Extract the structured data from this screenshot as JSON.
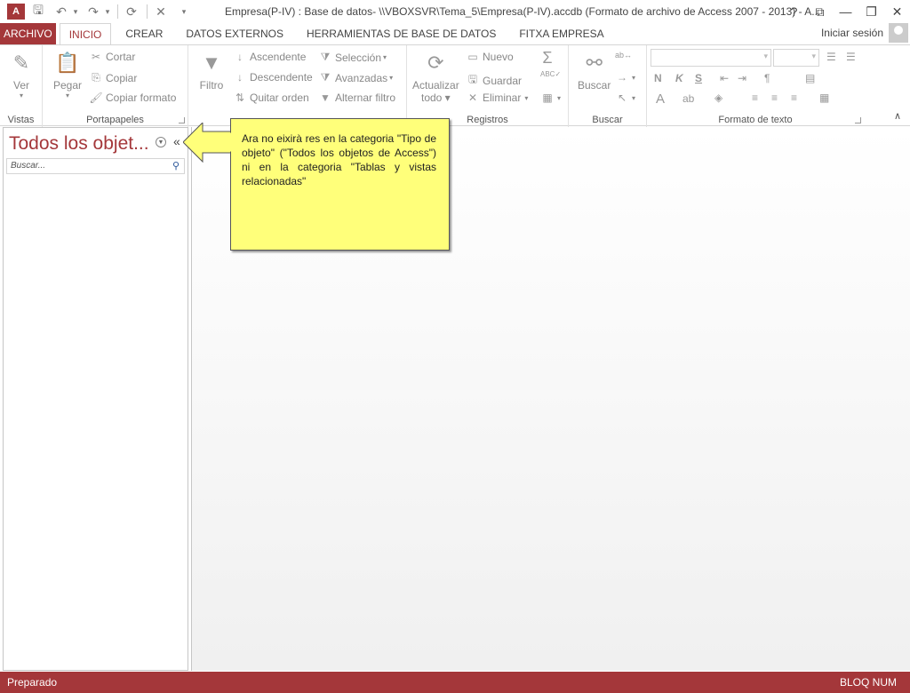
{
  "window": {
    "title": "Empresa(P-IV) : Base de datos- \\\\VBOXSVR\\Tema_5\\Empresa(P-IV).accdb (Formato de archivo de Access 2007 - 2013) - A...",
    "app_icon": "A",
    "help": "?",
    "restore_ribbon": "⧉",
    "minimize": "—",
    "maximize": "❐",
    "close": "✕"
  },
  "tabs": {
    "file": "ARCHIVO",
    "items": [
      "INICIO",
      "CREAR",
      "DATOS EXTERNOS",
      "HERRAMIENTAS DE BASE DE DATOS",
      "FITXA EMPRESA"
    ],
    "active": "INICIO",
    "signin": "Iniciar sesión"
  },
  "ribbon": {
    "vistas": {
      "label": "Vistas",
      "ver": "Ver"
    },
    "portapapeles": {
      "label": "Portapapeles",
      "pegar": "Pegar",
      "cortar": "Cortar",
      "copiar": "Copiar",
      "copiar_formato": "Copiar formato"
    },
    "ordenar": {
      "filtro": "Filtro",
      "ascendente": "Ascendente",
      "descendente": "Descendente",
      "quitar_orden": "Quitar orden",
      "seleccion": "Selección",
      "avanzadas": "Avanzadas",
      "alternar_filtro": "Alternar filtro"
    },
    "registros": {
      "label": "Registros",
      "actualizar": "Actualizar",
      "todo": "todo",
      "nuevo": "Nuevo",
      "guardar": "Guardar",
      "eliminar": "Eliminar"
    },
    "buscar": {
      "label": "Buscar",
      "buscar": "Buscar"
    },
    "formato": {
      "label": "Formato de texto",
      "bold": "N",
      "italic": "K",
      "underline": "S",
      "font_color": "A"
    }
  },
  "navpane": {
    "title": "Todos los objet...",
    "collapse": "«",
    "search_placeholder": "Buscar..."
  },
  "callout": {
    "text": "Ara no eixirà res en la categoria \"Tipo de objeto\" (\"Todos los objetos de Access\") ni en la categoria \"Tablas y vistas relacionadas\""
  },
  "status": {
    "left": "Preparado",
    "right": "BLOQ NUM"
  },
  "colors": {
    "accent": "#a4373a",
    "callout": "#ffff7a"
  }
}
